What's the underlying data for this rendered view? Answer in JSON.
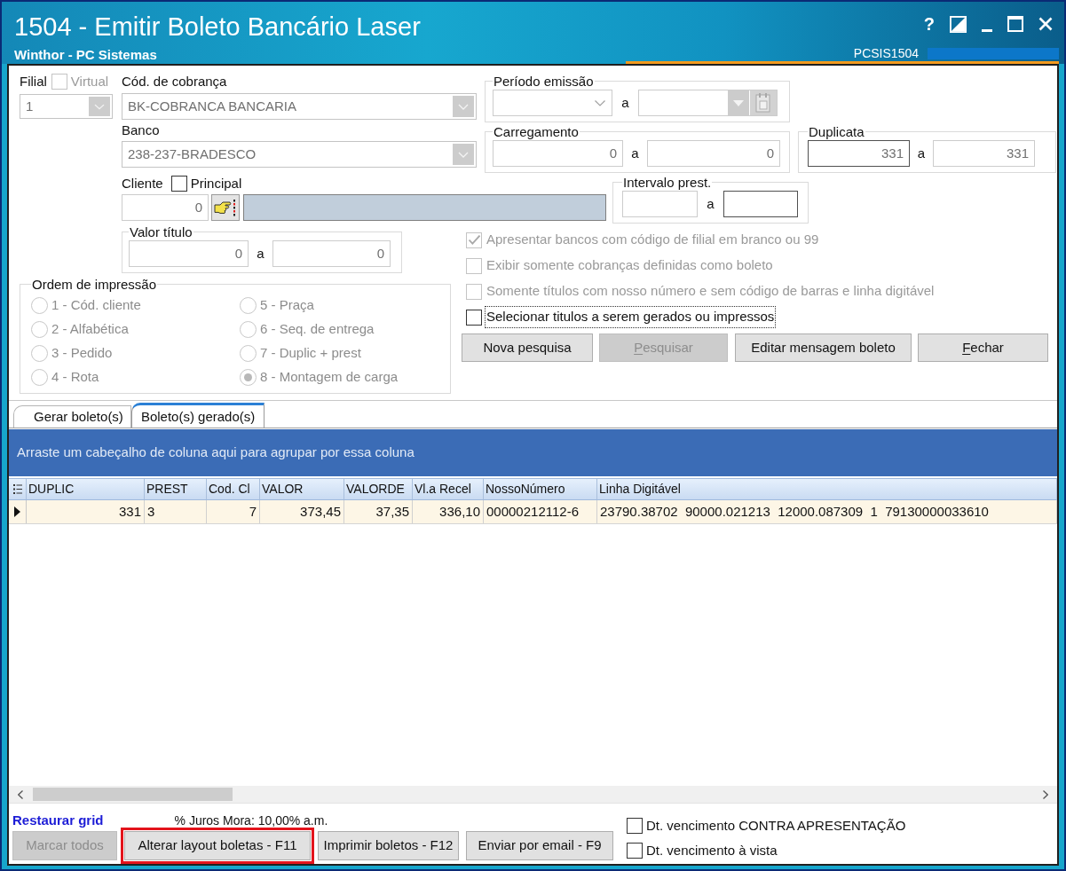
{
  "window": {
    "title": "1504 - Emitir Boleto Bancário Laser",
    "subtitle": "Winthor - PC Sistemas",
    "help": "?",
    "program_code": "PCSIS1504"
  },
  "filial": {
    "label": "Filial",
    "virtual": {
      "label": "Virtual",
      "checked": false,
      "disabled": true
    },
    "value": "1",
    "disabled": true
  },
  "cod_cobranca": {
    "label": "Cód. de cobrança",
    "value": "BK-COBRANCA BANCARIA",
    "disabled": true
  },
  "banco": {
    "label": "Banco",
    "value": "238-237-BRADESCO",
    "disabled": true
  },
  "cliente": {
    "label": "Cliente",
    "principal": {
      "label": "Principal",
      "checked": false,
      "disabled": false
    },
    "value": "0"
  },
  "periodo_emissao": {
    "label": "Período emissão",
    "separator": "a"
  },
  "carregamento": {
    "label": "Carregamento",
    "from": {
      "value": "0",
      "active": false
    },
    "separator": "a",
    "to": {
      "value": "0",
      "active": false
    }
  },
  "duplicata": {
    "label": "Duplicata",
    "from": {
      "value": "331",
      "active": true
    },
    "separator": "a",
    "to": {
      "value": "331",
      "active": false
    }
  },
  "intervalo_prest": {
    "label": "Intervalo prest.",
    "from": {
      "active": false
    },
    "separator": "a",
    "to": {
      "active": true
    }
  },
  "valor_titulo": {
    "label": "Valor título",
    "from": {
      "value": "0",
      "active": false
    },
    "separator": "a",
    "to": {
      "value": "0",
      "active": false
    }
  },
  "ordem_impressao": {
    "label": "Ordem de impressão",
    "disabled": true,
    "options": [
      {
        "label": "1 - Cód. cliente",
        "selected": false
      },
      {
        "label": "2 - Alfabética",
        "selected": false
      },
      {
        "label": "3 - Pedido",
        "selected": false
      },
      {
        "label": "4 - Rota",
        "selected": false
      },
      {
        "label": "5 - Praça",
        "selected": false
      },
      {
        "label": "6 - Seq. de entrega",
        "selected": false
      },
      {
        "label": "7 - Duplic + prest",
        "selected": false
      },
      {
        "label": "8 - Montagem de carga",
        "selected": true
      }
    ]
  },
  "options": [
    {
      "label": "Apresentar bancos com código de filial em branco ou 99",
      "checked": true,
      "disabled": true,
      "focused": false
    },
    {
      "label": "Exibir somente cobranças definidas como boleto",
      "checked": false,
      "disabled": true,
      "focused": false
    },
    {
      "label": "Somente títulos com nosso número e sem código de barras e linha digitável",
      "checked": false,
      "disabled": true,
      "focused": false
    },
    {
      "label": "Selecionar titulos a serem gerados ou impressos",
      "checked": false,
      "disabled": false,
      "focused": true
    }
  ],
  "actions": [
    {
      "label": "Nova pesquisa",
      "disabled": false,
      "mnemonic": false
    },
    {
      "label": "Pesquisar",
      "disabled": true,
      "mnemonic": true
    },
    {
      "label": "Editar mensagem boleto",
      "disabled": false,
      "mnemonic": false
    },
    {
      "label": "Fechar",
      "disabled": false,
      "mnemonic": true
    }
  ],
  "tabs": [
    {
      "label": "Gerar boleto(s)",
      "selected": false
    },
    {
      "label": "Boleto(s) gerado(s)",
      "selected": true
    }
  ],
  "grid": {
    "group_panel": "Arraste um cabeçalho de coluna aqui para agrupar por essa coluna",
    "columns": [
      {
        "label": "DUPLIC",
        "kind": "number"
      },
      {
        "label": "PREST",
        "kind": "text"
      },
      {
        "label": "Cod. Cl",
        "kind": "number"
      },
      {
        "label": "VALOR",
        "kind": "number"
      },
      {
        "label": "VALORDE",
        "kind": "number"
      },
      {
        "label": "Vl.a Recel",
        "kind": "number"
      },
      {
        "label": "NossoNúmero",
        "kind": "text"
      },
      {
        "label": "Linha Digitável",
        "kind": "text"
      }
    ],
    "rows": [
      {
        "selected": true,
        "cells": [
          "331",
          "3",
          "7",
          "373,45",
          "37,35",
          "336,10",
          "00000212112-6",
          "23790.38702  90000.021213  12000.087309  1  79130000033610"
        ]
      }
    ]
  },
  "footer": {
    "restore_link": "Restaurar grid",
    "interest": "% Juros Mora: 10,00% a.m.",
    "buttons": [
      {
        "label": "Marcar todos",
        "disabled": true,
        "highlighted": false
      },
      {
        "label": "Alterar layout boletas - F11",
        "disabled": false,
        "highlighted": true
      },
      {
        "label": "Imprimir boletos - F12",
        "disabled": false,
        "highlighted": false
      },
      {
        "label": "Enviar por email - F9",
        "disabled": false,
        "highlighted": false
      }
    ],
    "checks": [
      {
        "label": "Dt. vencimento CONTRA APRESENTAÇÃO",
        "checked": false
      },
      {
        "label": "Dt. vencimento à vista",
        "checked": false
      }
    ]
  }
}
